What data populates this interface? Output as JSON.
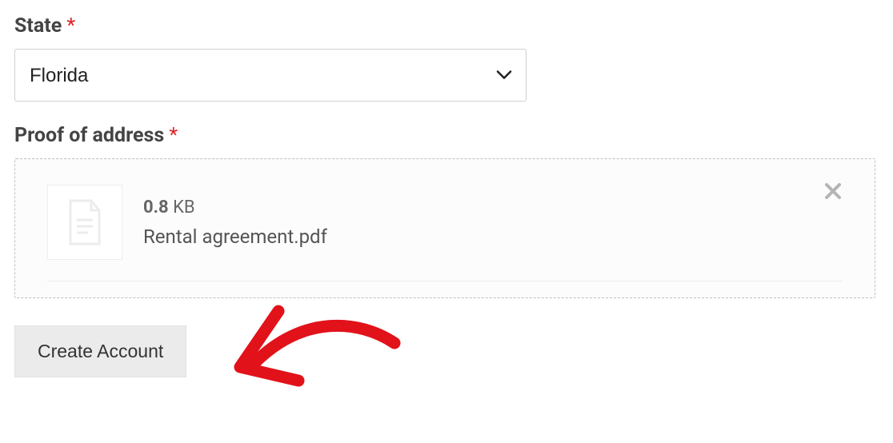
{
  "state_field": {
    "label": "State",
    "required_marker": "*",
    "value": "Florida"
  },
  "proof_field": {
    "label": "Proof of address",
    "required_marker": "*",
    "file": {
      "size_number": "0.8",
      "size_unit": "KB",
      "name": "Rental agreement.pdf"
    }
  },
  "submit": {
    "label": "Create Account"
  }
}
